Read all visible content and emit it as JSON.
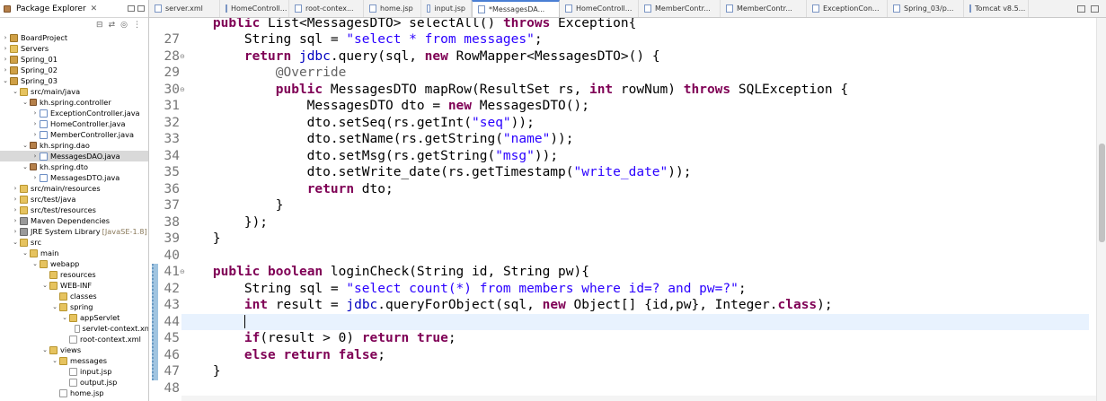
{
  "explorer": {
    "title": "Package Explorer",
    "tree": [
      {
        "label": "BoardProject",
        "icon": "project-icon",
        "arrow": "›"
      },
      {
        "label": "Servers",
        "icon": "folder-icon",
        "arrow": "›"
      },
      {
        "label": "Spring_01",
        "icon": "project-icon",
        "arrow": "›"
      },
      {
        "label": "Spring_02",
        "icon": "project-icon",
        "arrow": "›"
      },
      {
        "label": "Spring_03",
        "icon": "project-icon",
        "arrow": "⌄"
      },
      {
        "label": "src/main/java",
        "icon": "folder-icon",
        "arrow": "⌄"
      },
      {
        "label": "kh.spring.controller",
        "icon": "package-icon",
        "arrow": "⌄"
      },
      {
        "label": "ExceptionController.java",
        "icon": "java-file-icon",
        "arrow": "›"
      },
      {
        "label": "HomeController.java",
        "icon": "java-file-icon",
        "arrow": "›"
      },
      {
        "label": "MemberController.java",
        "icon": "java-file-icon",
        "arrow": "›"
      },
      {
        "label": "kh.spring.dao",
        "icon": "package-icon",
        "arrow": "⌄"
      },
      {
        "label": "MessagesDAO.java",
        "icon": "java-file-icon",
        "arrow": "›"
      },
      {
        "label": "kh.spring.dto",
        "icon": "package-icon",
        "arrow": "⌄"
      },
      {
        "label": "MessagesDTO.java",
        "icon": "java-file-icon",
        "arrow": "›"
      },
      {
        "label": "src/main/resources",
        "icon": "folder-icon",
        "arrow": "›"
      },
      {
        "label": "src/test/java",
        "icon": "folder-icon",
        "arrow": "›"
      },
      {
        "label": "src/test/resources",
        "icon": "folder-icon",
        "arrow": "›"
      },
      {
        "label": "Maven Dependencies",
        "icon": "library-icon",
        "arrow": "›"
      },
      {
        "label": "JRE System Library",
        "extra": "[JavaSE-1.8]",
        "icon": "library-icon",
        "arrow": "›"
      },
      {
        "label": "src",
        "icon": "folder-icon",
        "arrow": "⌄"
      },
      {
        "label": "main",
        "icon": "folder-icon",
        "arrow": "⌄"
      },
      {
        "label": "webapp",
        "icon": "folder-icon",
        "arrow": "⌄"
      },
      {
        "label": "resources",
        "icon": "folder-icon",
        "arrow": ""
      },
      {
        "label": "WEB-INF",
        "icon": "folder-icon",
        "arrow": "⌄"
      },
      {
        "label": "classes",
        "icon": "folder-icon",
        "arrow": ""
      },
      {
        "label": "spring",
        "icon": "folder-icon",
        "arrow": "⌄"
      },
      {
        "label": "appServlet",
        "icon": "folder-icon",
        "arrow": "⌄"
      },
      {
        "label": "servlet-context.xn",
        "icon": "xml-file-icon",
        "arrow": ""
      },
      {
        "label": "root-context.xml",
        "icon": "xml-file-icon",
        "arrow": ""
      },
      {
        "label": "views",
        "icon": "folder-icon",
        "arrow": "⌄"
      },
      {
        "label": "messages",
        "icon": "folder-icon",
        "arrow": "⌄"
      },
      {
        "label": "input.jsp",
        "icon": "jsp-file-icon",
        "arrow": ""
      },
      {
        "label": "output.jsp",
        "icon": "jsp-file-icon",
        "arrow": ""
      },
      {
        "label": "home.jsp",
        "icon": "jsp-file-icon",
        "arrow": ""
      }
    ]
  },
  "tabs": [
    {
      "label": "server.xml"
    },
    {
      "label": "HomeControll..."
    },
    {
      "label": "root-contex..."
    },
    {
      "label": "home.jsp"
    },
    {
      "label": "input.jsp"
    },
    {
      "label": "*MessagesDA..."
    },
    {
      "label": "HomeControll..."
    },
    {
      "label": "MemberContr..."
    },
    {
      "label": "MemberContr..."
    },
    {
      "label": "ExceptionCon..."
    },
    {
      "label": "Spring_03/p..."
    },
    {
      "label": "Tomcat v8.5..."
    }
  ],
  "editor": {
    "line_numbers": [
      "27",
      "28",
      "29",
      "30",
      "31",
      "32",
      "33",
      "34",
      "35",
      "36",
      "37",
      "38",
      "39",
      "40",
      "41",
      "42",
      "43",
      "44",
      "45",
      "46",
      "47",
      "48"
    ],
    "top_partial": "    public List<MessagesDTO> selectAll() throws Exception{"
  }
}
